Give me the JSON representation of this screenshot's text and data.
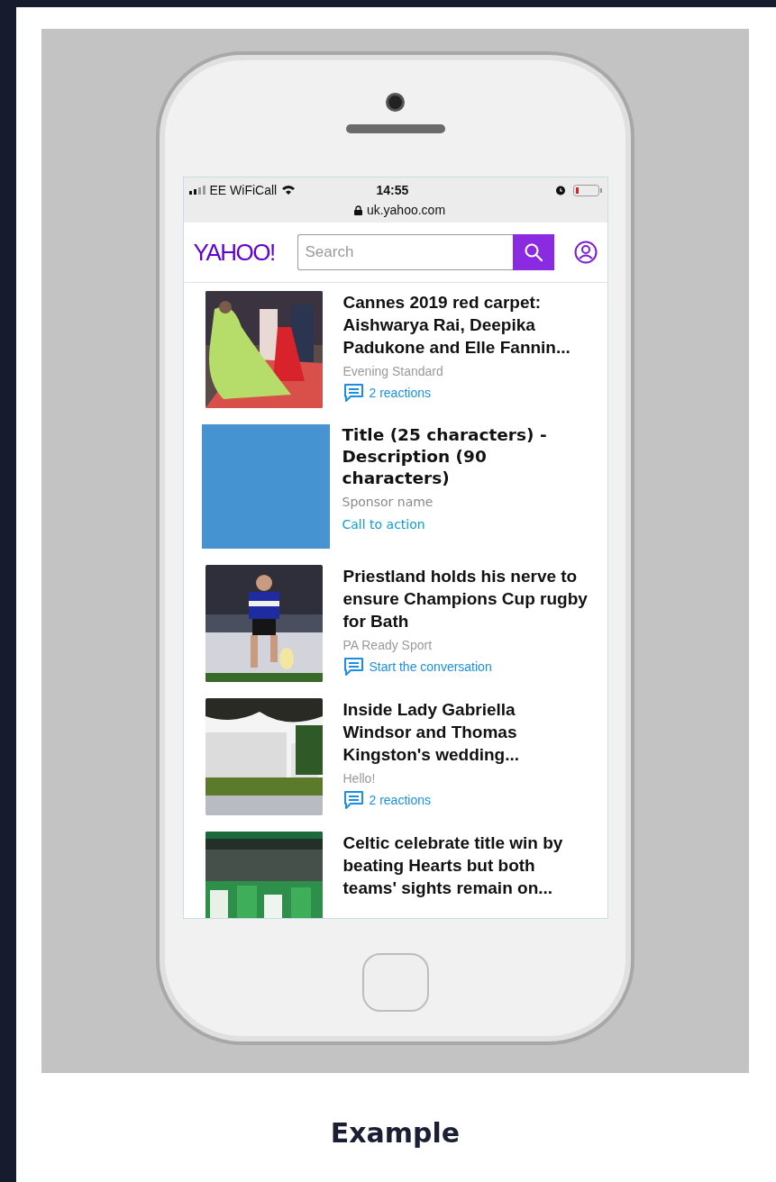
{
  "status_bar": {
    "carrier": "EE WiFiCall",
    "time": "14:55",
    "url": "uk.yahoo.com"
  },
  "header": {
    "logo": "YAHOO!",
    "search": {
      "placeholder": "Search"
    }
  },
  "feed": [
    {
      "kind": "article",
      "title": "Cannes 2019 red carpet: Aishwarya Rai, Deepika Padukone and Elle Fannin...",
      "source": "Evening Standard",
      "comments": "2 reactions"
    },
    {
      "kind": "ad",
      "title": "Title (25 characters) - Description (90 characters)",
      "sponsor": "Sponsor name",
      "cta": "Call to action"
    },
    {
      "kind": "article",
      "title": "Priestland holds his nerve to ensure Champions Cup rugby for Bath",
      "source": "PA Ready Sport",
      "comments": "Start the conversation"
    },
    {
      "kind": "article",
      "title": "Inside Lady Gabriella Windsor and Thomas Kingston's wedding...",
      "source": "Hello!",
      "comments": "2 reactions"
    },
    {
      "kind": "article",
      "title": "Celtic celebrate title win by beating Hearts but both teams' sights remain on..."
    }
  ],
  "caption": "Example"
}
